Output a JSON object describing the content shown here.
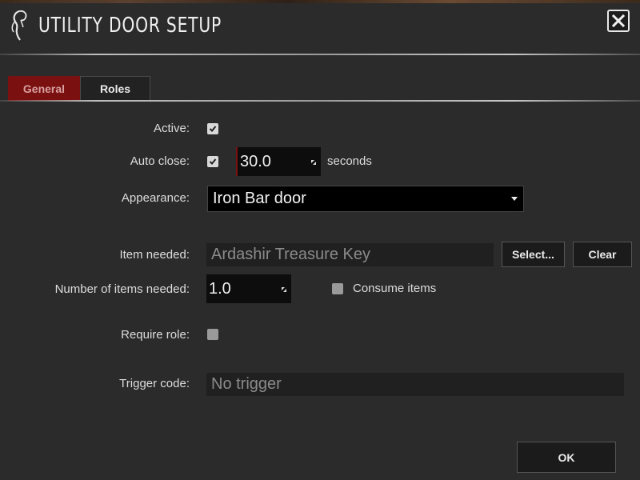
{
  "window": {
    "title": "UTILITY DOOR SETUP",
    "close_label": "close"
  },
  "tabs": [
    {
      "label": "General",
      "active": true
    },
    {
      "label": "Roles",
      "active": false
    }
  ],
  "form": {
    "active": {
      "label": "Active:",
      "checked": true
    },
    "auto_close": {
      "label": "Auto close:",
      "checked": true,
      "value": "30.0",
      "unit": "seconds"
    },
    "appearance": {
      "label": "Appearance:",
      "value": "Iron Bar door"
    },
    "item_needed": {
      "label": "Item needed:",
      "value": "Ardashir Treasure Key",
      "select_label": "Select...",
      "clear_label": "Clear"
    },
    "items_count": {
      "label": "Number of items needed:",
      "value": "1.0",
      "consume_label": "Consume items",
      "consume_checked": false
    },
    "require_role": {
      "label": "Require role:",
      "checked": false
    },
    "trigger_code": {
      "label": "Trigger code:",
      "placeholder": "No trigger"
    }
  },
  "footer": {
    "ok_label": "OK"
  },
  "colors": {
    "accent": "#7a1010",
    "background": "#2b2b2b",
    "field": "#0d0d0d"
  }
}
